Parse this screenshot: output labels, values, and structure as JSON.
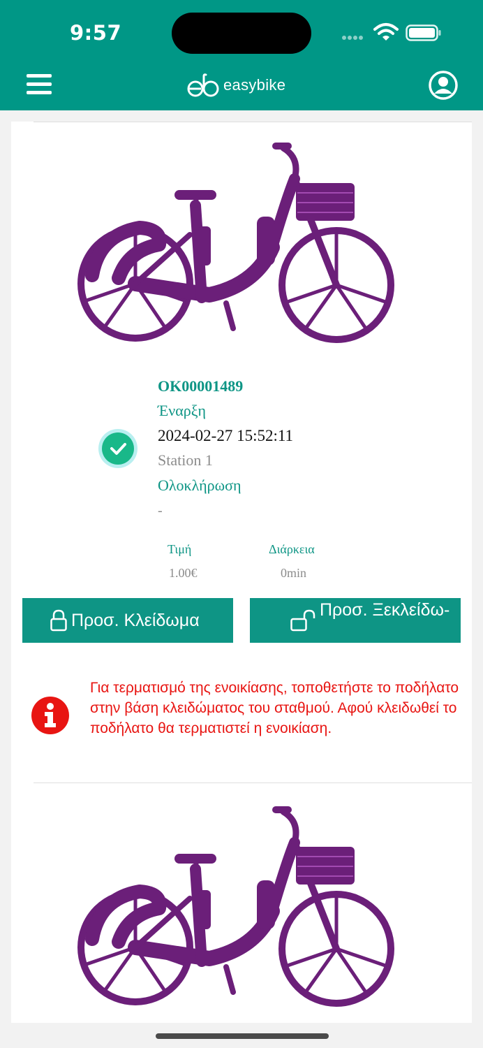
{
  "status_bar": {
    "time": "9:57",
    "icons": [
      "cellular-icon",
      "wifi-icon",
      "battery-icon"
    ]
  },
  "header": {
    "menu_icon": "hamburger-menu-icon",
    "logo_text": "easybike",
    "profile_icon": "user-profile-icon",
    "background": "#009786"
  },
  "rental": {
    "id": "OK00001489",
    "start_label": "Έναρξη",
    "start_datetime": "2024-02-27 15:52:11",
    "start_station": "Station 1",
    "end_label": "Ολοκλήρωση",
    "end_value": "-",
    "status_icon": "check-circle-icon",
    "price_label": "Τιμή",
    "price_value": "1.00€",
    "duration_label": "Διάρκεια",
    "duration_value": "0min"
  },
  "actions": {
    "lock_label": "Προσ. Κλείδωμα",
    "unlock_label": "Προσ. Ξεκλείδω-"
  },
  "notice": {
    "icon": "info-icon",
    "text": "Για τερματισμό της ενοικίασης, τοποθετήστε το ποδήλατο στην βάση κλειδώματος του σταθμού. Αφού κλειδωθεί το ποδήλατο θα τερματιστεί η ενοικίαση."
  },
  "colors": {
    "accent": "#0e9585",
    "bike": "#6b1f79",
    "error": "#e81512"
  }
}
